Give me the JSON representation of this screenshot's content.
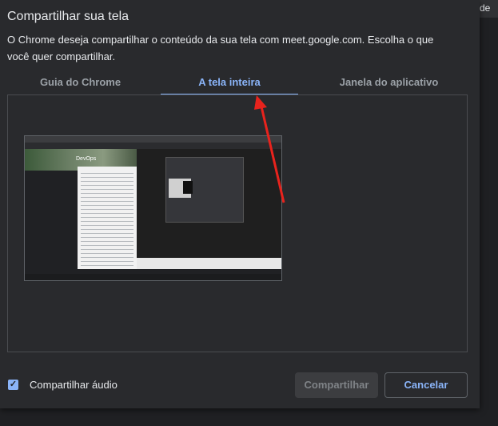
{
  "background": {
    "corner_text": "de"
  },
  "dialog": {
    "title": "Compartilhar sua tela",
    "description": "O Chrome deseja compartilhar o conteúdo da sua tela com meet.google.com. Escolha o que você quer compartilhar.",
    "tabs": [
      {
        "label": "Guia do Chrome",
        "active": false
      },
      {
        "label": "A tela inteira",
        "active": true
      },
      {
        "label": "Janela do aplicativo",
        "active": false
      }
    ],
    "preview": {
      "title_text": "DevOps"
    },
    "share_audio": {
      "label": "Compartilhar áudio",
      "checked": true
    },
    "buttons": {
      "share": "Compartilhar",
      "cancel": "Cancelar"
    }
  },
  "annotation": {
    "arrow_color": "#e8231d"
  },
  "colors": {
    "accent": "#8ab4f8",
    "dialog_bg": "#292a2d"
  }
}
